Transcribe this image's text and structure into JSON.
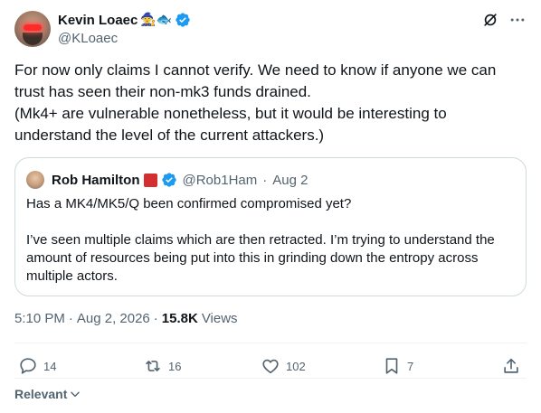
{
  "author": {
    "display_name": "Kevin Loaec",
    "emojis": "🧙🐟",
    "handle": "@KLoaec"
  },
  "post": {
    "text": "For now only claims I cannot verify. We need to know if anyone we can trust has seen their non-mk3 funds drained.\n(Mk4+ are vulnerable nonetheless, but it would be interesting to understand the level of the current attackers.)"
  },
  "quote": {
    "display_name": "Rob Hamilton",
    "handle": "@Rob1Ham",
    "separator": "·",
    "date": "Aug 2",
    "text": "Has a MK4/MK5/Q been confirmed compromised yet?\n\nI’ve seen multiple claims which are then retracted. I’m trying to understand the amount of resources being put into this in grinding down the entropy across multiple actors."
  },
  "meta": {
    "time": "5:10 PM",
    "separator": "·",
    "date": "Aug 2, 2026",
    "separator2": "·",
    "views_count": "15.8K",
    "views_label": "Views"
  },
  "actions": {
    "replies": "14",
    "reposts": "16",
    "likes": "102",
    "bookmarks": "7"
  },
  "sort": {
    "label": "Relevant"
  },
  "colors": {
    "verified": "#1d9bf0",
    "muted": "#536471",
    "text": "#0f1419",
    "border": "#cfd9de",
    "flag": "#d32f2f"
  },
  "icons": [
    "grok-icon",
    "more-icon",
    "verified-badge-icon",
    "reply-icon",
    "repost-icon",
    "like-icon",
    "bookmark-icon",
    "share-icon",
    "chevron-down-icon"
  ]
}
